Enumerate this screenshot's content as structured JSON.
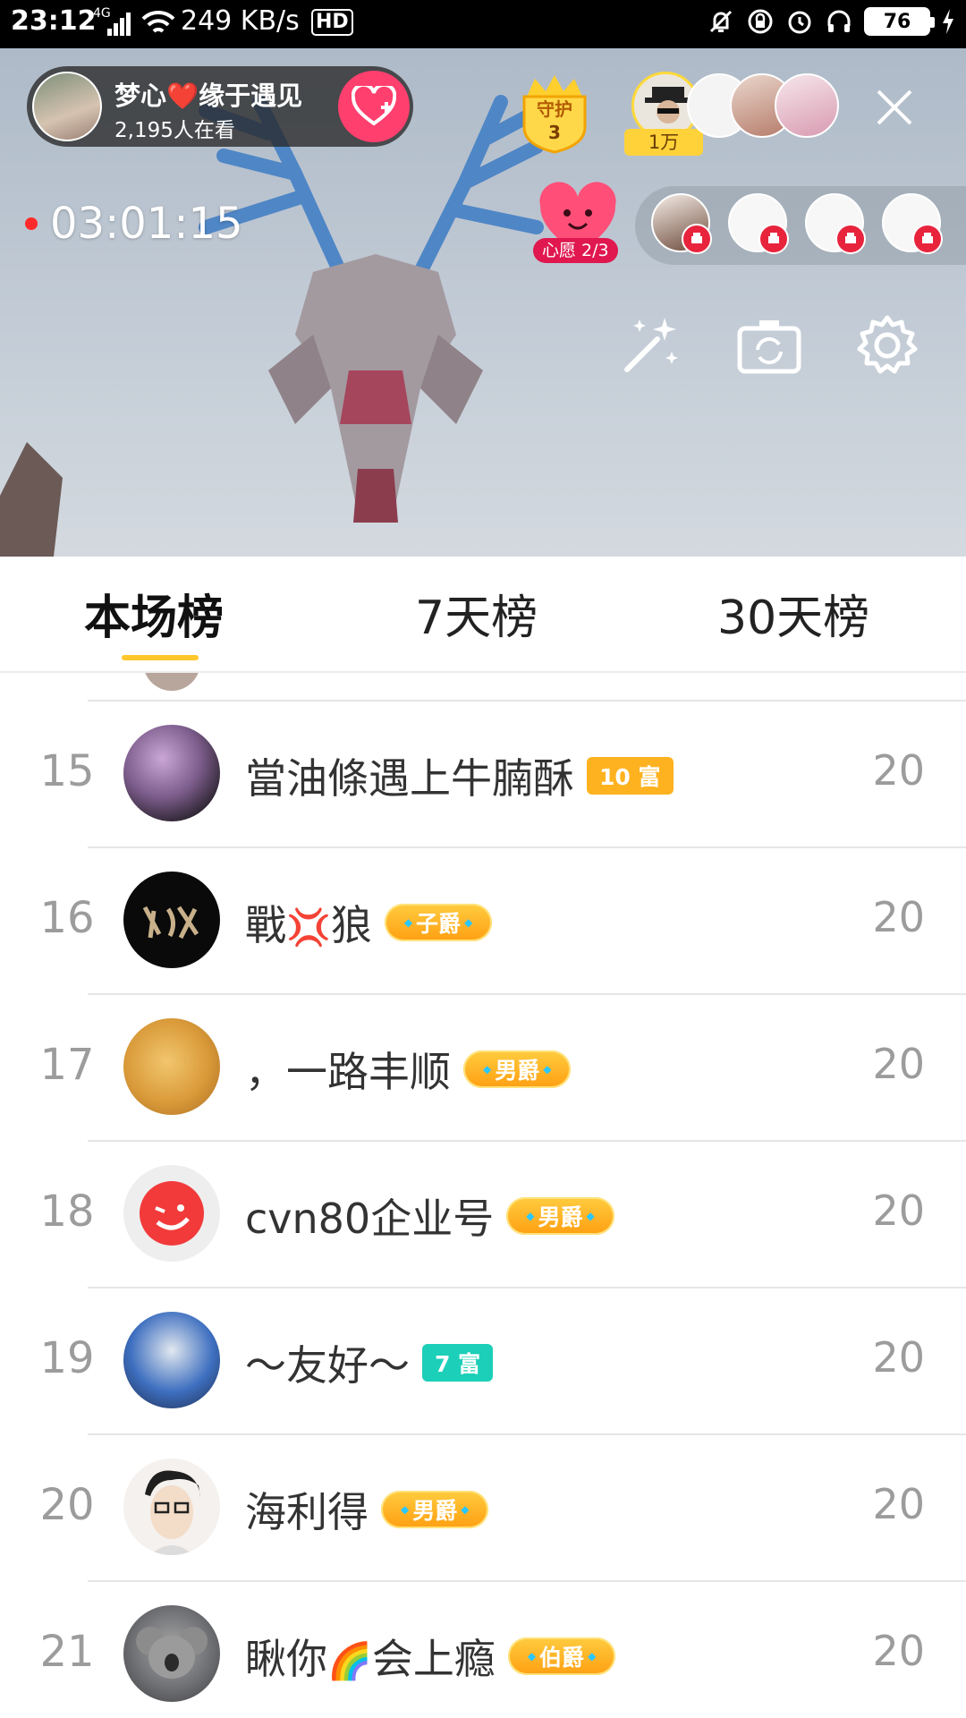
{
  "status_bar": {
    "time": "23:12",
    "network": "4G",
    "speed": "249 KB/s",
    "hd": "HD",
    "battery": "76"
  },
  "live": {
    "host_name": "梦心❤️缘于遇见",
    "viewers": "2,195人在看",
    "guard_label": "守护",
    "guard_count": "3",
    "top_fan_amount": "1万",
    "timer": "03:01:15",
    "wish_label": "心愿 2/3"
  },
  "tabs": [
    {
      "label": "本场榜",
      "active": true
    },
    {
      "label": "7天榜",
      "active": false
    },
    {
      "label": "30天榜",
      "active": false
    }
  ],
  "ranking": [
    {
      "rank": "15",
      "name": "當油條遇上牛腩酥",
      "badge": "10 富",
      "badge_type": "rich",
      "score": "20"
    },
    {
      "rank": "16",
      "name_parts": [
        "戰",
        "💢",
        "狼"
      ],
      "badge": "子爵",
      "badge_type": "noble",
      "score": "20"
    },
    {
      "rank": "17",
      "name": "，一路丰顺",
      "badge": "男爵",
      "badge_type": "noble",
      "score": "20"
    },
    {
      "rank": "18",
      "name": "cvn80企业号",
      "badge": "男爵",
      "badge_type": "noble",
      "score": "20"
    },
    {
      "rank": "19",
      "name": "～友好～",
      "badge": "7 富",
      "badge_type": "rich-teal",
      "score": "20"
    },
    {
      "rank": "20",
      "name": "海利得",
      "badge": "男爵",
      "badge_type": "noble",
      "score": "20"
    },
    {
      "rank": "21",
      "name_parts": [
        "瞅你",
        "🌈",
        "会上瘾"
      ],
      "badge": "伯爵",
      "badge_type": "noble",
      "score": "20"
    }
  ],
  "colors": {
    "accent": "#ffc72c",
    "follow": "#ff3f6e",
    "live_dot": "#ff2a2a",
    "rank_gray": "#9c9c9c"
  }
}
